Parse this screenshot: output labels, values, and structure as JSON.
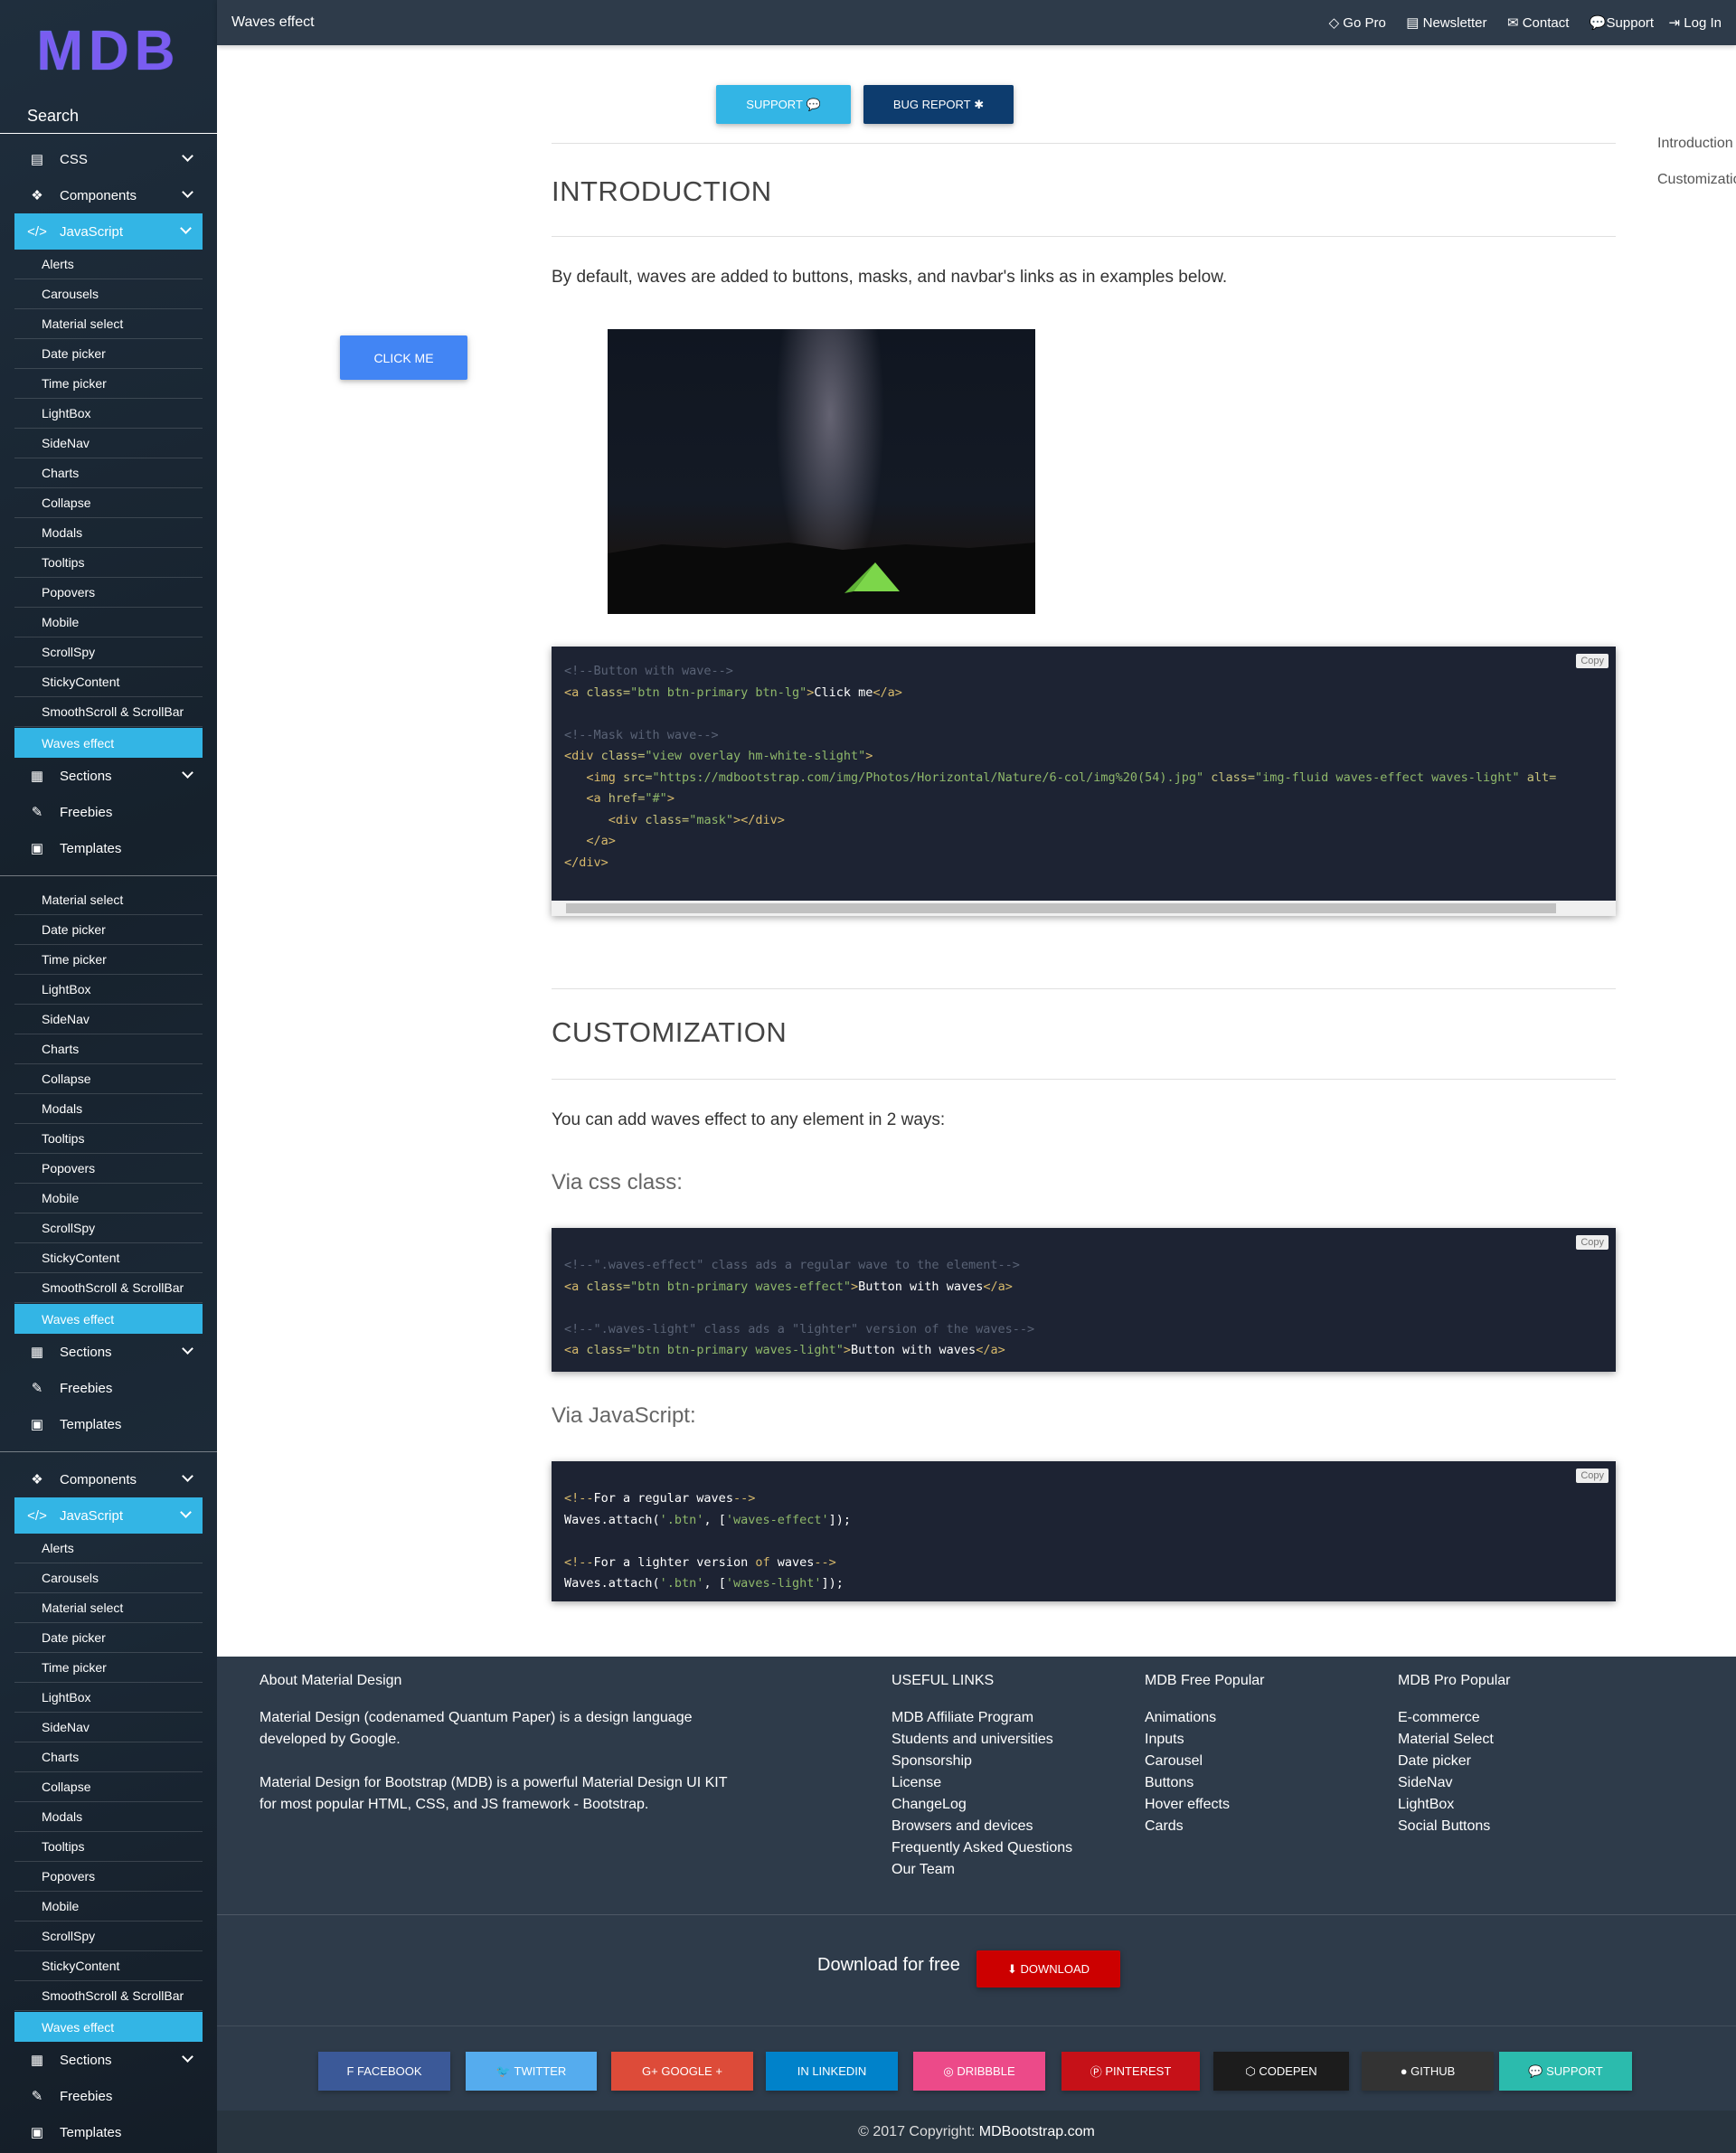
{
  "logo": "MDB",
  "search_label": "Search",
  "sidebar": {
    "group1": {
      "css": "CSS",
      "components": "Components",
      "javascript": "JavaScript",
      "items": [
        "Alerts",
        "Carousels",
        "Material select",
        "Date picker",
        "Time picker",
        "LightBox",
        "SideNav",
        "Charts",
        "Collapse",
        "Modals",
        "Tooltips",
        "Popovers",
        "Mobile",
        "ScrollSpy",
        "StickyContent",
        "SmoothScroll & ScrollBar",
        "Waves effect"
      ],
      "sections": "Sections",
      "freebies": "Freebies",
      "templates": "Templates"
    },
    "group2": {
      "items": [
        "Material select",
        "Date picker",
        "Time picker",
        "LightBox",
        "SideNav",
        "Charts",
        "Collapse",
        "Modals",
        "Tooltips",
        "Popovers",
        "Mobile",
        "ScrollSpy",
        "StickyContent",
        "SmoothScroll & ScrollBar",
        "Waves effect"
      ],
      "sections": "Sections",
      "freebies": "Freebies",
      "templates": "Templates"
    },
    "group3": {
      "components": "Components",
      "javascript": "JavaScript",
      "items": [
        "Alerts",
        "Carousels",
        "Material select",
        "Date picker",
        "Time picker",
        "LightBox",
        "SideNav",
        "Charts",
        "Collapse",
        "Modals",
        "Tooltips",
        "Popovers",
        "Mobile",
        "ScrollSpy",
        "StickyContent",
        "SmoothScroll & ScrollBar",
        "Waves effect"
      ],
      "sections": "Sections",
      "freebies": "Freebies",
      "templates": "Templates"
    }
  },
  "topbar": {
    "title": "Waves effect",
    "nav": [
      "Go Pro",
      "Newsletter",
      "Contact",
      "Support",
      "Log In"
    ]
  },
  "buttons": {
    "support": "SUPPORT",
    "bug_report": "BUG REPORT",
    "click_me": "CLICK ME"
  },
  "toc": [
    "Introduction",
    "Customization"
  ],
  "intro": {
    "heading": "INTRODUCTION",
    "text": "By default, waves are added to buttons, masks, and navbar's links as in examples below."
  },
  "copy_label": "Copy",
  "custom": {
    "heading": "CUSTOMIZATION",
    "text": "You can add waves effect to any element in 2 ways:",
    "via_css": "Via css class:",
    "via_js": "Via JavaScript:"
  },
  "footer": {
    "about_title": "About Material Design",
    "about_p1": "Material Design (codenamed Quantum Paper) is a design language developed by Google.",
    "about_p2": "Material Design for Bootstrap (MDB) is a powerful Material Design UI KIT for most popular HTML, CSS, and JS framework - Bootstrap.",
    "useful_title": "USEFUL LINKS",
    "useful": [
      "MDB Affiliate Program",
      "Students and universities",
      "Sponsorship",
      "License",
      "ChangeLog",
      "Browsers and devices",
      "Frequently Asked Questions",
      "Our Team"
    ],
    "free_title": "MDB Free Popular",
    "free": [
      "Animations",
      "Inputs",
      "Carousel",
      "Buttons",
      "Hover effects",
      "Cards"
    ],
    "pro_title": "MDB Pro Popular",
    "pro": [
      "E-commerce",
      "Material Select",
      "Date picker",
      "SideNav",
      "LightBox",
      "Social Buttons"
    ],
    "download_text": "Download for free",
    "download_btn": "DOWNLOAD",
    "social": [
      "FACEBOOK",
      "TWITTER",
      "GOOGLE +",
      "LINKEDIN",
      "DRIBBBLE",
      "PINTEREST",
      "CODEPEN",
      "GITHUB",
      "SUPPORT"
    ],
    "copyright": "© 2017 Copyright: ",
    "copyright_site": "MDBootstrap.com"
  },
  "colors": {
    "primary": "#4285f4",
    "info": "#33b5e5",
    "bug": "#0d3c6e",
    "download": "#cc0000",
    "facebook": "#3b5998",
    "twitter": "#55acee",
    "google": "#dd4b39",
    "linkedin": "#0082ca",
    "dribbble": "#ec4a89",
    "pinterest": "#c61118",
    "codepen": "#1c1c1c",
    "github": "#333333",
    "support": "#2bbbad"
  }
}
